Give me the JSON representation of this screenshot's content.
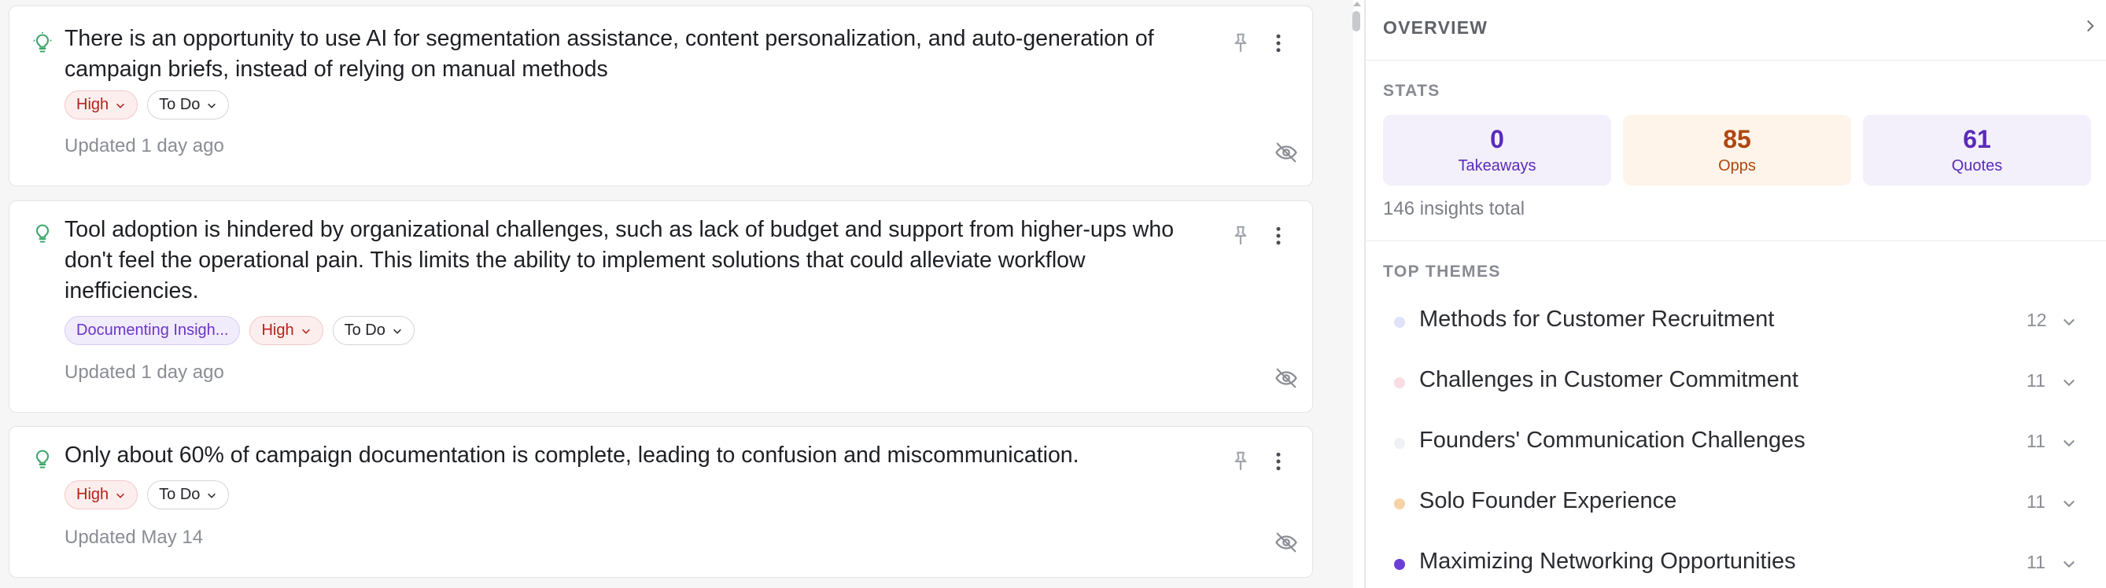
{
  "insights": [
    {
      "text": "There is an opportunity to use AI for segmentation assistance, content personalization, and auto-generation of campaign briefs, instead of relying on manual methods",
      "tags": [
        {
          "kind": "high",
          "label": "High"
        },
        {
          "kind": "todo",
          "label": "To Do"
        }
      ],
      "updated": "Updated 1 day ago"
    },
    {
      "text": "Tool adoption is hindered by organizational challenges, such as lack of budget and support from higher-ups who don't feel the operational pain. This limits the ability to implement solutions that could alleviate workflow inefficiencies.",
      "tags": [
        {
          "kind": "theme",
          "label": "Documenting Insigh..."
        },
        {
          "kind": "high",
          "label": "High"
        },
        {
          "kind": "todo",
          "label": "To Do"
        }
      ],
      "updated": "Updated 1 day ago"
    },
    {
      "text": "Only about 60% of campaign documentation is complete, leading to confusion and miscommunication.",
      "tags": [
        {
          "kind": "high",
          "label": "High"
        },
        {
          "kind": "todo",
          "label": "To Do"
        }
      ],
      "updated": "Updated May 14"
    }
  ],
  "overview": {
    "title": "OVERVIEW",
    "stats_header": "STATS",
    "stats": [
      {
        "value": "0",
        "label": "Takeaways"
      },
      {
        "value": "85",
        "label": "Opps"
      },
      {
        "value": "61",
        "label": "Quotes"
      }
    ],
    "total": "146 insights total",
    "themes_header": "TOP THEMES",
    "themes": [
      {
        "name": "Methods for Customer Recruitment",
        "count": "12",
        "color": "#dfe3f7"
      },
      {
        "name": "Challenges in Customer Commitment",
        "count": "11",
        "color": "#f9dde3"
      },
      {
        "name": "Founders' Communication Challenges",
        "count": "11",
        "color": "#eef0f3"
      },
      {
        "name": "Solo Founder Experience",
        "count": "11",
        "color": "#f6d3a6"
      },
      {
        "name": "Maximizing Networking Opportunities",
        "count": "11",
        "color": "#6d3fd6"
      }
    ]
  },
  "colors": {
    "accent_purple": "#5b2bb8",
    "accent_orange": "#b0470f",
    "high_red": "#b42318"
  }
}
